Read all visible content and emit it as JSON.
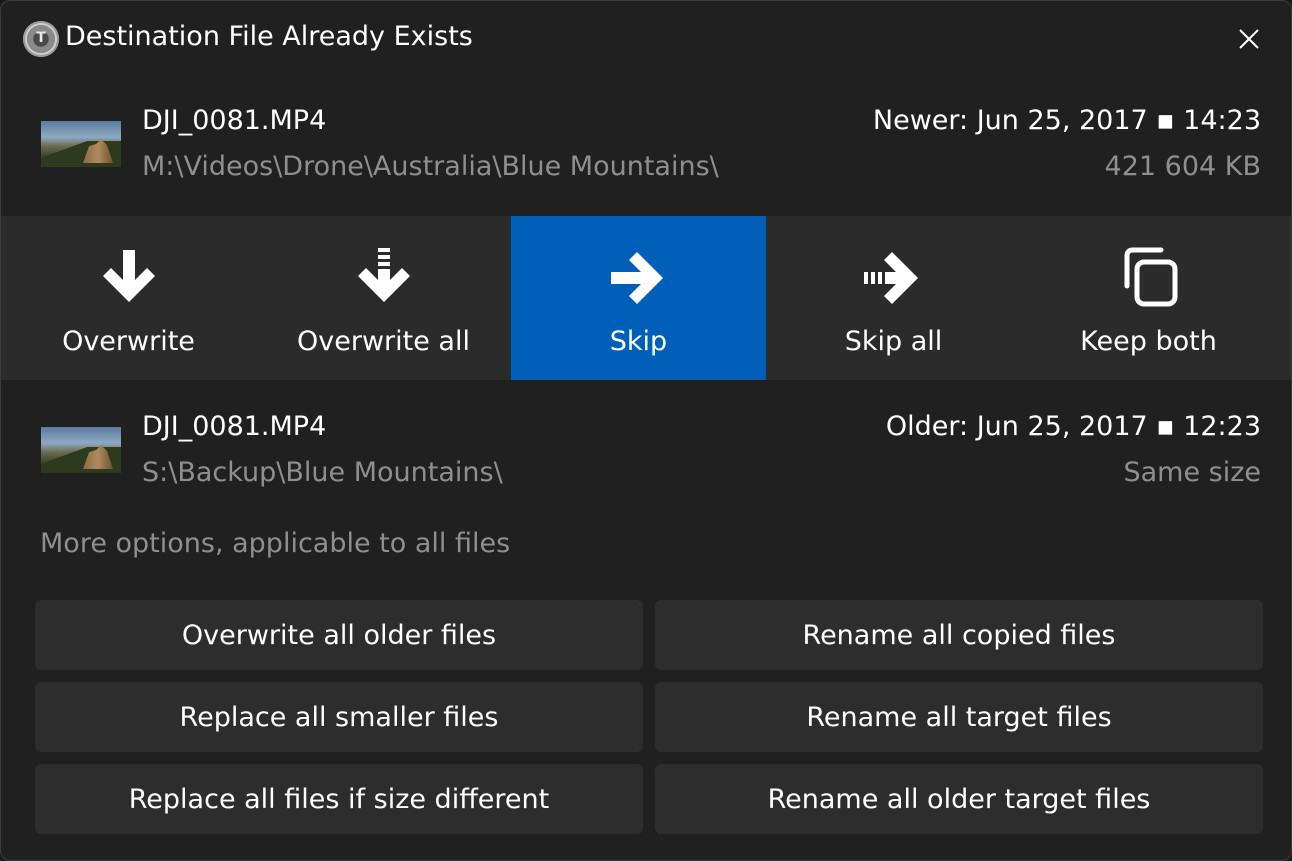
{
  "window": {
    "title": "Destination File Already Exists",
    "close_icon": "close-icon"
  },
  "source_file": {
    "name": "DJI_0081.MP4",
    "path": "M:\\Videos\\Drone\\Australia\\Blue Mountains\\",
    "date": "Newer: Jun 25, 2017 ▪ 14:23",
    "size": "421 604 KB"
  },
  "target_file": {
    "name": "DJI_0081.MP4",
    "path": "S:\\Backup\\Blue Mountains\\",
    "date": "Older: Jun 25, 2017 ▪ 12:23",
    "size": "Same size"
  },
  "actions": [
    {
      "label": "Overwrite",
      "icon": "arrow-down-icon",
      "active": false
    },
    {
      "label": "Overwrite all",
      "icon": "arrow-down-all-icon",
      "active": false
    },
    {
      "label": "Skip",
      "icon": "arrow-right-icon",
      "active": true
    },
    {
      "label": "Skip all",
      "icon": "arrow-right-all-icon",
      "active": false
    },
    {
      "label": "Keep both",
      "icon": "copy-icon",
      "active": false
    }
  ],
  "more_options": {
    "label": "More options, applicable to all files",
    "buttons": [
      "Overwrite all older files",
      "Rename all copied files",
      "Replace all smaller files",
      "Rename all target files",
      "Replace all files if size different",
      "Rename all older target files"
    ]
  },
  "colors": {
    "accent": "#005fb8",
    "background": "#202020",
    "action_bar": "#2b2b2b",
    "button": "#2d2d2d",
    "muted_text": "#8f8f8f"
  }
}
